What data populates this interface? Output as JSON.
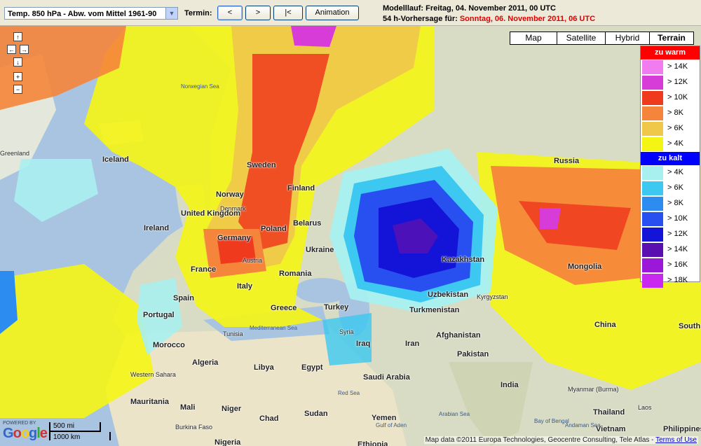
{
  "toolbar": {
    "product": "Temp. 850 hPa - Abw. vom Mittel 1961-90",
    "termin_label": "Termin:",
    "btn_prev": "<",
    "btn_next": ">",
    "btn_first": "|<",
    "btn_animation": "Animation",
    "model_run": "Modelllauf: Freitag, 04. November 2011, 00 UTC",
    "forecast_prefix": "54 h-Vorhersage für: ",
    "forecast_date": "Sonntag, 06. November 2011, 06 UTC"
  },
  "map_types": [
    "Map",
    "Satellite",
    "Hybrid",
    "Terrain"
  ],
  "active_map_type": "Terrain",
  "nav": {
    "up": "↑",
    "left": "←",
    "right": "→",
    "down": "↓",
    "zoom_in": "+",
    "zoom_out": "−"
  },
  "legend": {
    "warm_title": "zu warm",
    "warm_color": "#ff0000",
    "warm": [
      {
        "label": "> 14K",
        "color": "#f07cf0"
      },
      {
        "label": "> 12K",
        "color": "#d83cd8"
      },
      {
        "label": "> 10K",
        "color": "#f03a1e"
      },
      {
        "label": "> 8K",
        "color": "#f5853a"
      },
      {
        "label": "> 6K",
        "color": "#efc84a"
      },
      {
        "label": "> 4K",
        "color": "#f5f514"
      }
    ],
    "cold_title": "zu kalt",
    "cold_color": "#0000ff",
    "cold": [
      {
        "label": "> 4K",
        "color": "#a8f0f0"
      },
      {
        "label": "> 6K",
        "color": "#3cc8f0"
      },
      {
        "label": "> 8K",
        "color": "#2c8cf0"
      },
      {
        "label": "> 10K",
        "color": "#2850f0"
      },
      {
        "label": "> 12K",
        "color": "#1414d8"
      },
      {
        "label": "> 14K",
        "color": "#5a10b0"
      },
      {
        "label": "> 16K",
        "color": "#9c18d8"
      },
      {
        "label": "> 18K",
        "color": "#c828f0"
      }
    ]
  },
  "places": [
    "Greenland",
    "Iceland",
    "Norwegian Sea",
    "Norway",
    "Sweden",
    "Finland",
    "Denmark",
    "United Kingdom",
    "Ireland",
    "Germany",
    "Poland",
    "Belarus",
    "Ukraine",
    "France",
    "Austria",
    "Romania",
    "Italy",
    "Spain",
    "Portugal",
    "Greece",
    "Turkey",
    "Tunisia",
    "Mediterranean Sea",
    "Morocco",
    "Algeria",
    "Libya",
    "Egypt",
    "Western Sahara",
    "Mauritania",
    "Mali",
    "Niger",
    "Chad",
    "Sudan",
    "Burkina Faso",
    "Nigeria",
    "Ethiopia",
    "Iraq",
    "Iran",
    "Syria",
    "Saudi Arabia",
    "Yemen",
    "Gulf of Aden",
    "Red Sea",
    "Afghanistan",
    "Pakistan",
    "India",
    "Turkmenistan",
    "Uzbekistan",
    "Kazakhstan",
    "Kyrgyzstan",
    "Russia",
    "Mongolia",
    "China",
    "Myanmar (Burma)",
    "Thailand",
    "Vietnam",
    "Philippines",
    "Bay of Bengal",
    "Andaman Sea",
    "Arabian Sea",
    "South China",
    "Laos"
  ],
  "scale": {
    "miles": "500 mi",
    "km": "1000 km"
  },
  "google": {
    "powered": "POWERED BY",
    "logo": "Google"
  },
  "copyright": "Map data ©2011 Europa Technologies, Geocentre Consulting, Tele Atlas - ",
  "terms": "Terms of Use"
}
